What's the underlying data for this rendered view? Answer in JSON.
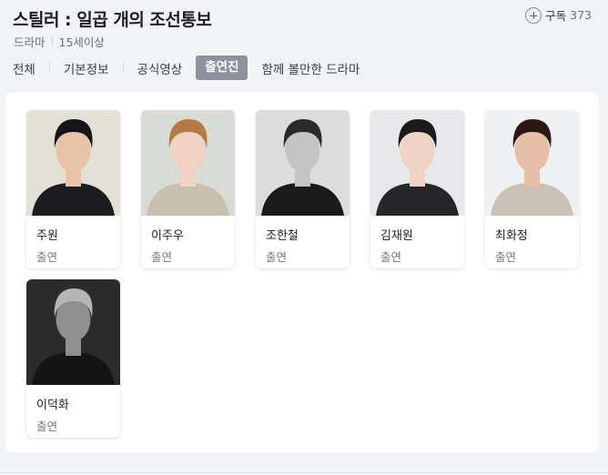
{
  "header": {
    "title": "스틸러 : 일곱 개의 조선통보",
    "genre": "드라마",
    "rating": "15세이상",
    "subscribe_label": "구독",
    "subscribe_count": "373"
  },
  "tabs": [
    {
      "label": "전체",
      "active": false
    },
    {
      "label": "기본정보",
      "active": false
    },
    {
      "label": "공식영상",
      "active": false
    },
    {
      "label": "출연진",
      "active": true
    },
    {
      "label": "함께 볼만한 드라마",
      "active": false
    }
  ],
  "cast": [
    {
      "name": "주원",
      "role": "출연",
      "bg": "#e3e0d6",
      "hair": "#16161a",
      "skin": "#e8c3a8",
      "shirt": "#1d1d20"
    },
    {
      "name": "이주우",
      "role": "출연",
      "bg": "#d9dbd7",
      "hair": "#b57a45",
      "skin": "#f0d3c2",
      "shirt": "#c9bfae"
    },
    {
      "name": "조한철",
      "role": "출연",
      "bg": "#dcdcdc",
      "hair": "#2a2a2a",
      "skin": "#c4c4c4",
      "shirt": "#1a1a1a"
    },
    {
      "name": "김재원",
      "role": "출연",
      "bg": "#e8e8ea",
      "hair": "#1c1a1a",
      "skin": "#efd3c4",
      "shirt": "#26262a"
    },
    {
      "name": "최화정",
      "role": "출연",
      "bg": "#eef0f2",
      "hair": "#2a1814",
      "skin": "#e6bfa8",
      "shirt": "#c9c2b5"
    },
    {
      "name": "이덕화",
      "role": "출연",
      "bg": "#2b2b2b",
      "hair": "#b5b5b5",
      "skin": "#8f8f8f",
      "shirt": "#141414"
    }
  ]
}
